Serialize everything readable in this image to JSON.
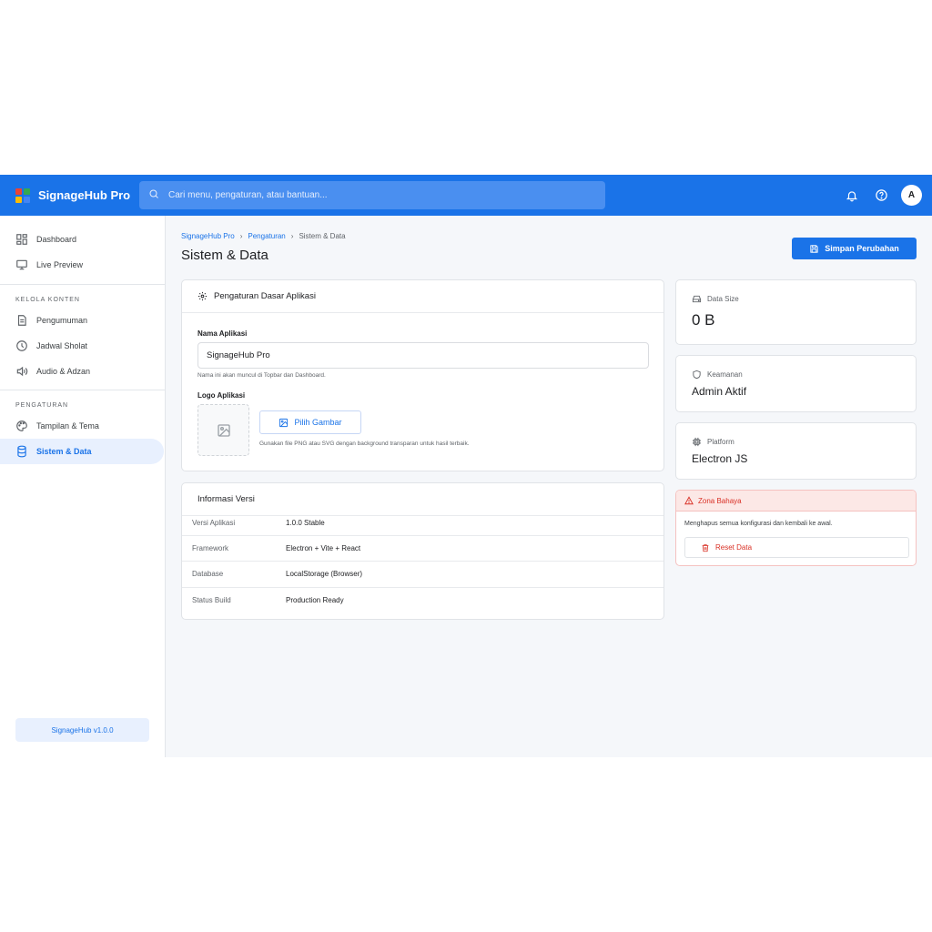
{
  "topbar": {
    "app_name": "SignageHub Pro",
    "search_placeholder": "Cari menu, pengaturan, atau bantuan...",
    "avatar_initial": "A",
    "brand_colors": [
      "#ea4335",
      "#34a853",
      "#fbbc04",
      "#4285f4"
    ],
    "icons": [
      "search-icon",
      "bell-icon",
      "help-icon"
    ]
  },
  "sidebar": {
    "top_items": [
      {
        "label": "Dashboard",
        "icon": "dashboard-icon"
      },
      {
        "label": "Live Preview",
        "icon": "monitor-icon"
      }
    ],
    "sections": [
      {
        "title": "KELOLA KONTEN",
        "items": [
          {
            "label": "Pengumuman",
            "icon": "document-icon"
          },
          {
            "label": "Jadwal Sholat",
            "icon": "clock-icon"
          },
          {
            "label": "Audio & Adzan",
            "icon": "speaker-icon"
          }
        ]
      },
      {
        "title": "PENGATURAN",
        "items": [
          {
            "label": "Tampilan & Tema",
            "icon": "palette-icon"
          },
          {
            "label": "Sistem & Data",
            "icon": "database-icon",
            "active": true
          }
        ]
      }
    ],
    "version": "SignageHub v1.0.0"
  },
  "main": {
    "breadcrumb": [
      "SignageHub Pro",
      "Pengaturan",
      "Sistem & Data"
    ],
    "title": "Sistem & Data",
    "save_label": "Simpan Perubahan",
    "settings_card": {
      "title": "Pengaturan Dasar Aplikasi",
      "name_label": "Nama Aplikasi",
      "name_value": "SignageHub Pro",
      "name_hint": "Nama ini akan muncul di Topbar dan Dashboard.",
      "logo_label": "Logo Aplikasi",
      "pick_label": "Pilih Gambar",
      "logo_hint": "Gunakan file PNG atau SVG dengan background transparan untuk hasil terbaik."
    },
    "version_card": {
      "title": "Informasi Versi",
      "rows": [
        {
          "key": "Versi Aplikasi",
          "value": "1.0.0 Stable"
        },
        {
          "key": "Framework",
          "value": "Electron + Vite + React"
        },
        {
          "key": "Database",
          "value": "LocalStorage (Browser)"
        },
        {
          "key": "Status Build",
          "value": "Production Ready"
        }
      ]
    },
    "stats": [
      {
        "label": "Data Size",
        "value": "0 B",
        "icon": "storage-icon"
      },
      {
        "label": "Keamanan",
        "value": "Admin Aktif",
        "icon": "shield-icon"
      },
      {
        "label": "Platform",
        "value": "Electron JS",
        "icon": "chip-icon"
      }
    ],
    "danger_zone": {
      "title": "Zona Bahaya",
      "description": "Menghapus semua konfigurasi dan kembali ke awal.",
      "reset_label": "Reset Data"
    }
  },
  "colors": {
    "primary": "#1a73e8",
    "danger": "#d93025",
    "danger_bg": "#fce8e6",
    "active_bg": "#e8f0fe"
  }
}
